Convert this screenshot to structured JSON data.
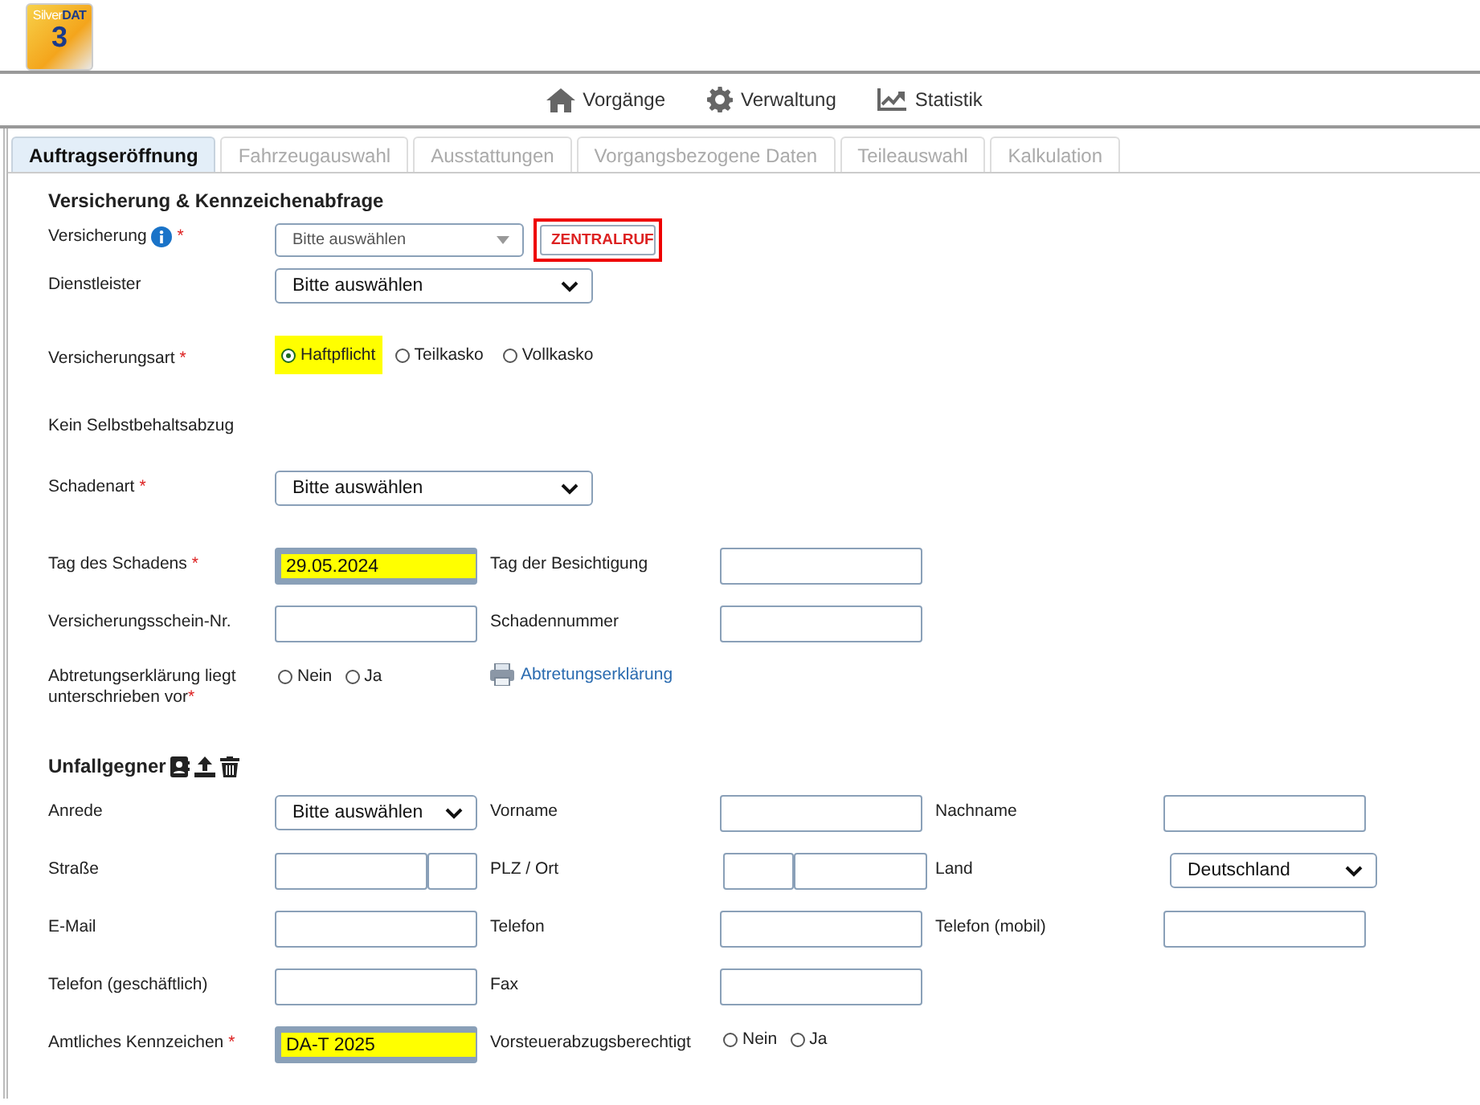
{
  "logo": {
    "brand": "Silver",
    "brand_bold": "DAT",
    "version": "3"
  },
  "nav": [
    {
      "label": "Vorgänge",
      "kind": "home"
    },
    {
      "label": "Verwaltung",
      "kind": "settings"
    },
    {
      "label": "Statistik",
      "kind": "statistics"
    }
  ],
  "tabs": [
    {
      "label": "Auftragseröffnung",
      "selected": true
    },
    {
      "label": "Fahrzeugauswahl",
      "selected": false
    },
    {
      "label": "Ausstattungen",
      "selected": false
    },
    {
      "label": "Vorgangsbezogene Daten",
      "selected": false
    },
    {
      "label": "Teileauswahl",
      "selected": false
    },
    {
      "label": "Kalkulation",
      "selected": false
    }
  ],
  "insurance": {
    "title": "Versicherung & Kennzeichenabfrage",
    "versicherung": {
      "label": "Versicherung",
      "mark": "*",
      "value": "Bitte auswählen",
      "button": "ZENTRALRUF"
    },
    "dienstleister": {
      "label": "Dienstleister",
      "value": "Bitte auswählen"
    },
    "versicherungsart": {
      "label": "Versicherungsart",
      "mark": "*",
      "options": [
        {
          "label": "Haftpflicht",
          "selected": true
        },
        {
          "label": "Teilkasko",
          "selected": false
        },
        {
          "label": "Vollkasko",
          "selected": false
        }
      ]
    },
    "note": "Kein Selbstbehaltsabzug",
    "schadenart": {
      "label": "Schadenart",
      "mark": "*",
      "value": "Bitte auswählen"
    },
    "tag_des_schadens": {
      "label": "Tag des Schadens",
      "mark": "*",
      "value": "29.05.2024",
      "highlighted": true
    },
    "tag_der_besichtigung": {
      "label": "Tag der Besichtigung"
    },
    "versicherungsschein": {
      "label": "Versicherungsschein-Nr."
    },
    "schadennummer": {
      "label": "Schadennummer"
    },
    "abtretung": {
      "label": "Abtretungserklärung liegt unterschrieben vor",
      "mark": "*",
      "options": [
        {
          "label": "Nein",
          "selected": false
        },
        {
          "label": "Ja",
          "selected": false
        }
      ],
      "link": "Abtretungserklärung"
    }
  },
  "opponent": {
    "title": "Unfallgegner",
    "rows": [
      [
        {
          "label": "Anrede",
          "kind": "select",
          "value": "Bitte auswählen"
        },
        {
          "label": "Vorname",
          "kind": "text"
        },
        {
          "label": "Nachname",
          "kind": "text"
        }
      ],
      [
        {
          "label": "Straße",
          "kind": "street"
        },
        {
          "label": "PLZ / Ort",
          "kind": "zipcity"
        },
        {
          "label": "Land",
          "kind": "select",
          "value": "Deutschland"
        }
      ],
      [
        {
          "label": "E-Mail",
          "kind": "text"
        },
        {
          "label": "Telefon",
          "kind": "text"
        },
        {
          "label": "Telefon (mobil)",
          "kind": "text"
        }
      ],
      [
        {
          "label": "Telefon (geschäftlich)",
          "kind": "text"
        },
        {
          "label": "Fax",
          "kind": "text"
        }
      ],
      [
        {
          "label": "Amtliches Kennzeichen",
          "kind": "text",
          "mark": "*",
          "value": "DA-T 2025",
          "highlighted": true
        },
        {
          "label": "Vorsteuerabzugsberechtigt",
          "kind": "radios",
          "options": [
            {
              "label": "Nein",
              "selected": false
            },
            {
              "label": "Ja",
              "selected": false
            }
          ]
        }
      ]
    ]
  }
}
